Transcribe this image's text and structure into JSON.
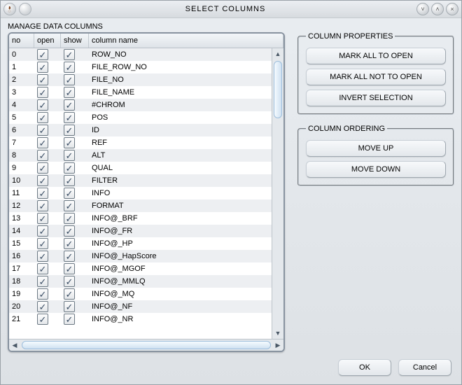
{
  "window": {
    "title": "SELECT COLUMNS"
  },
  "section_label": "MANAGE DATA COLUMNS",
  "headers": {
    "no": "no",
    "open": "open",
    "show": "show",
    "name": "column name"
  },
  "rows": [
    {
      "no": "0",
      "open": true,
      "show": true,
      "name": "ROW_NO"
    },
    {
      "no": "1",
      "open": true,
      "show": true,
      "name": "FILE_ROW_NO"
    },
    {
      "no": "2",
      "open": true,
      "show": true,
      "name": "FILE_NO"
    },
    {
      "no": "3",
      "open": true,
      "show": true,
      "name": "FILE_NAME"
    },
    {
      "no": "4",
      "open": true,
      "show": true,
      "name": "#CHROM"
    },
    {
      "no": "5",
      "open": true,
      "show": true,
      "name": "POS"
    },
    {
      "no": "6",
      "open": true,
      "show": true,
      "name": "ID"
    },
    {
      "no": "7",
      "open": true,
      "show": true,
      "name": "REF"
    },
    {
      "no": "8",
      "open": true,
      "show": true,
      "name": "ALT"
    },
    {
      "no": "9",
      "open": true,
      "show": true,
      "name": "QUAL"
    },
    {
      "no": "10",
      "open": true,
      "show": true,
      "name": "FILTER"
    },
    {
      "no": "11",
      "open": true,
      "show": true,
      "name": "INFO"
    },
    {
      "no": "12",
      "open": true,
      "show": true,
      "name": "FORMAT"
    },
    {
      "no": "13",
      "open": true,
      "show": true,
      "name": "INFO@_BRF"
    },
    {
      "no": "14",
      "open": true,
      "show": true,
      "name": "INFO@_FR"
    },
    {
      "no": "15",
      "open": true,
      "show": true,
      "name": "INFO@_HP"
    },
    {
      "no": "16",
      "open": true,
      "show": true,
      "name": "INFO@_HapScore"
    },
    {
      "no": "17",
      "open": true,
      "show": true,
      "name": "INFO@_MGOF"
    },
    {
      "no": "18",
      "open": true,
      "show": true,
      "name": "INFO@_MMLQ"
    },
    {
      "no": "19",
      "open": true,
      "show": true,
      "name": "INFO@_MQ"
    },
    {
      "no": "20",
      "open": true,
      "show": true,
      "name": "INFO@_NF"
    },
    {
      "no": "21",
      "open": true,
      "show": true,
      "name": "INFO@_NR"
    }
  ],
  "panels": {
    "properties": {
      "title": "COLUMN PROPERTIES",
      "mark_open": "MARK ALL TO OPEN",
      "mark_not_open": "MARK ALL NOT TO OPEN",
      "invert": "INVERT SELECTION"
    },
    "ordering": {
      "title": "COLUMN ORDERING",
      "up": "MOVE UP",
      "down": "MOVE DOWN"
    }
  },
  "footer": {
    "ok": "OK",
    "cancel": "Cancel"
  }
}
